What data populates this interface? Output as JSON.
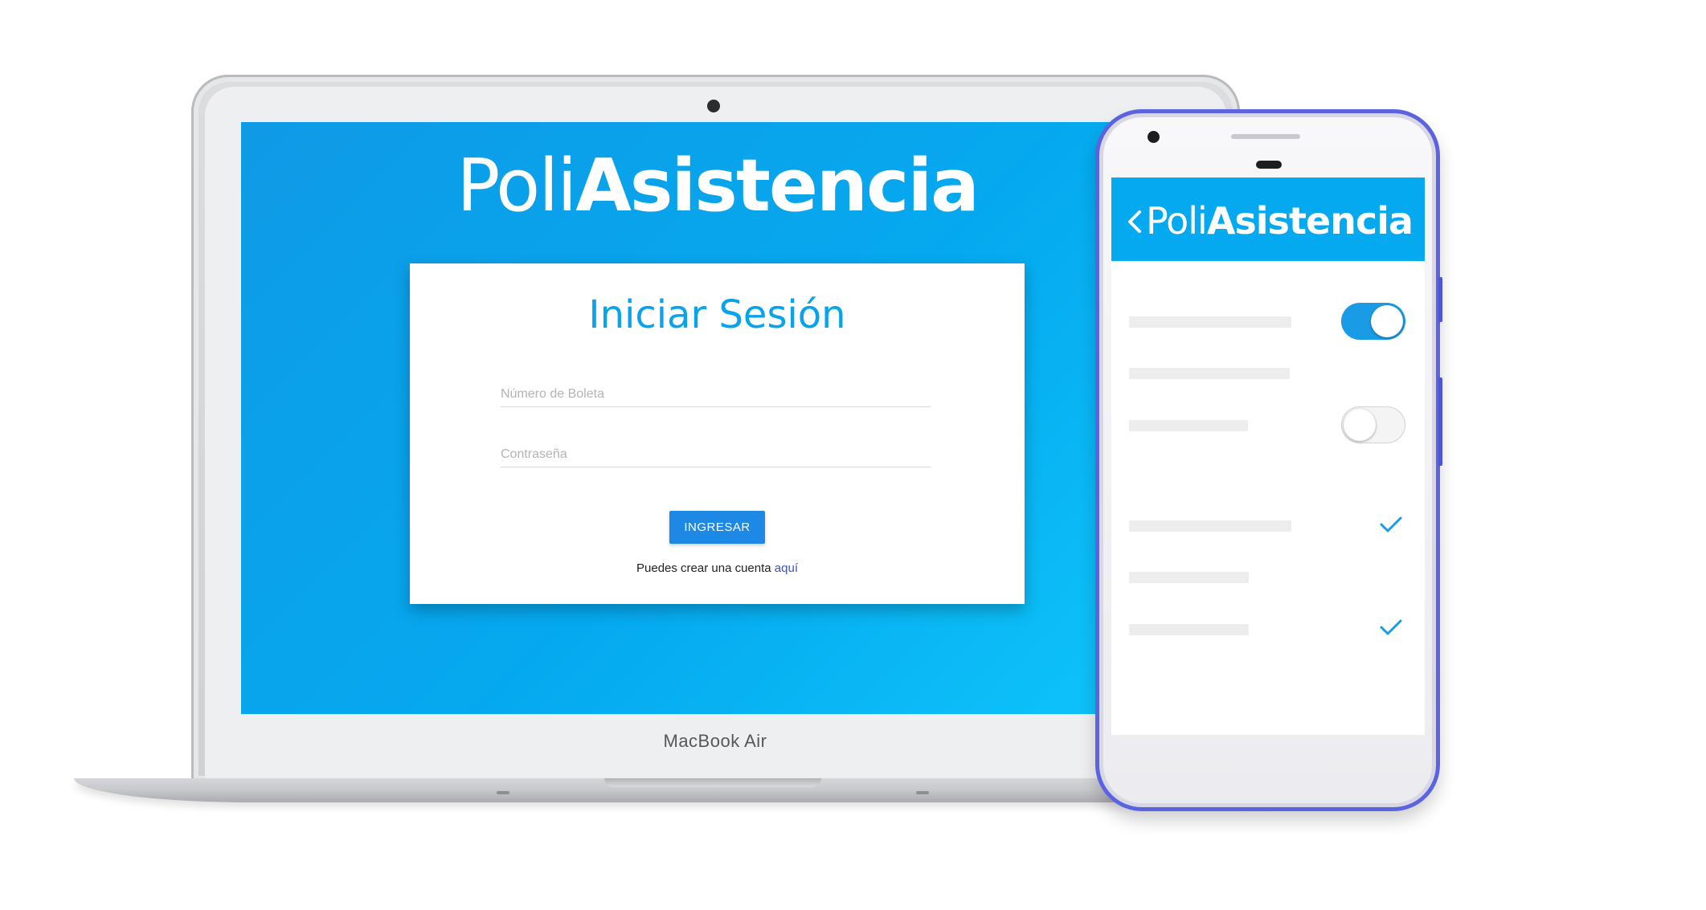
{
  "laptop": {
    "brand": "MacBook Air",
    "app": {
      "logo_light": "Poli",
      "logo_bold": "Asistencia",
      "login": {
        "title": "Iniciar Sesión",
        "boleta_placeholder": "Número de Boleta",
        "password_placeholder": "Contraseña",
        "submit_label": "INGRESAR",
        "signup_text": "Puedes crear una cuenta",
        "signup_link": "aquí"
      }
    }
  },
  "phone": {
    "header": {
      "back_icon": "chevron-left-icon",
      "title_light": "Poli",
      "title_bold": "Asistencia"
    },
    "toggles": [
      {
        "state": "on"
      },
      {
        "state": "off"
      }
    ],
    "checks": [
      {
        "icon": "check-icon"
      },
      {
        "icon": "check-icon"
      }
    ]
  },
  "colors": {
    "brand_blue": "#05a9ef",
    "button_blue": "#1e88e5",
    "link_indigo": "#3f51b5",
    "phone_frame": "#5b63e0"
  }
}
